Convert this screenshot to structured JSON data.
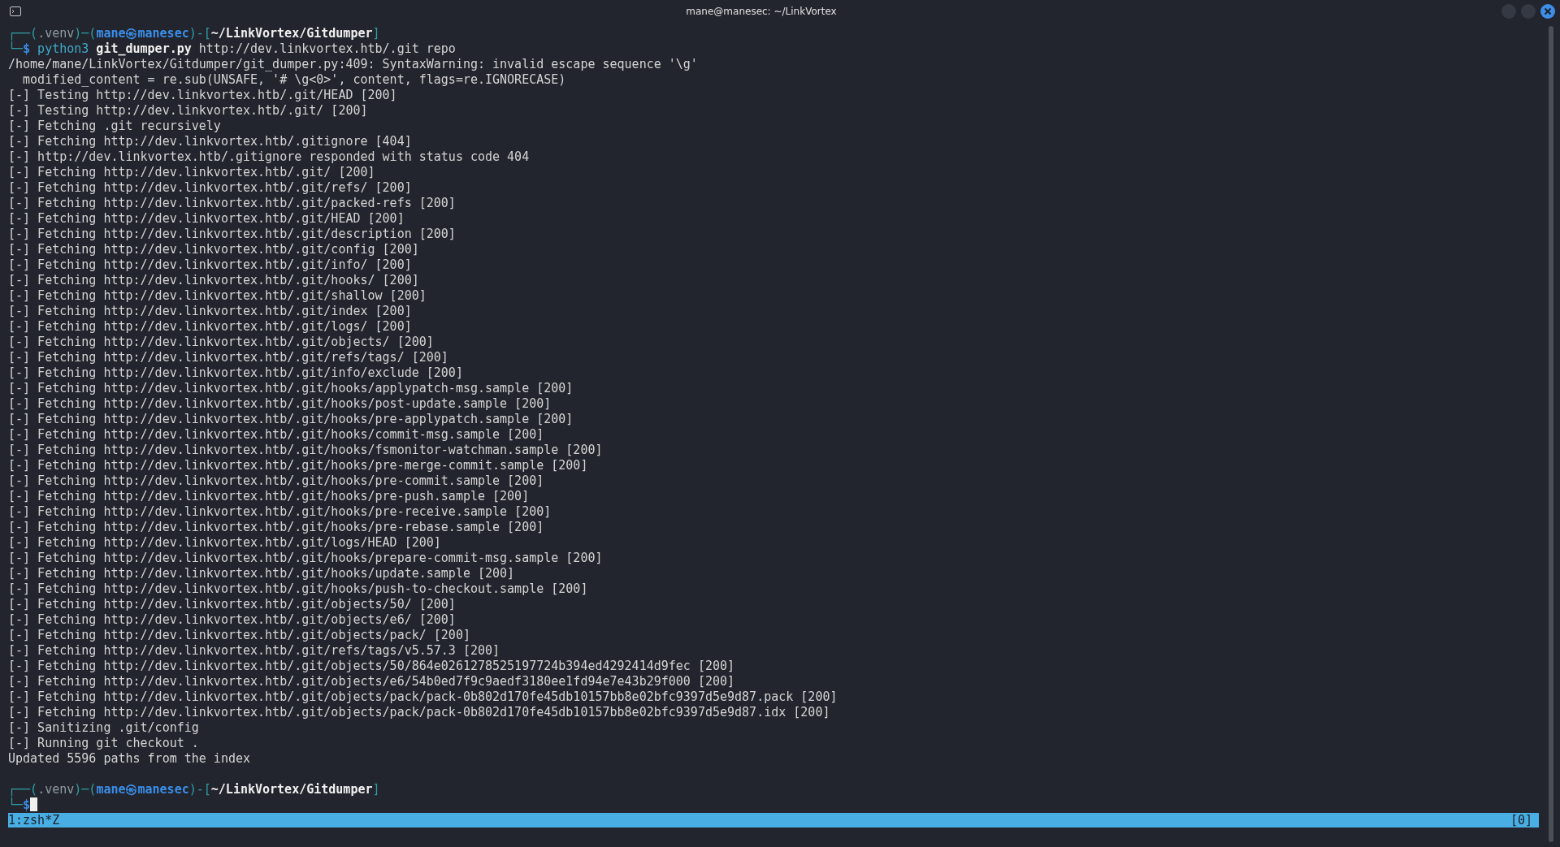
{
  "window": {
    "title": "mane@manesec: ~/LinkVortex"
  },
  "session": [
    {
      "kind": "prompt",
      "segments": [
        {
          "text": "┌──(",
          "kind": "frame"
        },
        {
          "text": ".venv",
          "kind": "venv"
        },
        {
          "text": ")─(",
          "kind": "frame"
        },
        {
          "text": "mane㉿manesec",
          "kind": "user"
        },
        {
          "text": ")-[",
          "kind": "frame"
        },
        {
          "text": "~/LinkVortex/Gitdumper",
          "kind": "path"
        },
        {
          "text": "]",
          "kind": "frame"
        }
      ]
    },
    {
      "kind": "prompt",
      "segments": [
        {
          "text": "└─",
          "kind": "frame"
        },
        {
          "text": "$",
          "kind": "user"
        },
        {
          "text": " python3",
          "kind": "program"
        },
        {
          "text": " git_dumper.py",
          "kind": "path"
        },
        {
          "text": " http://dev.linkvortex.htb/.git repo",
          "kind": "plain"
        }
      ]
    },
    {
      "kind": "output",
      "text": "/home/mane/LinkVortex/Gitdumper/git_dumper.py:409: SyntaxWarning: invalid escape sequence '\\g'"
    },
    {
      "kind": "output",
      "text": "  modified_content = re.sub(UNSAFE, '# \\g<0>', content, flags=re.IGNORECASE)"
    },
    {
      "kind": "output",
      "text": "[-] Testing http://dev.linkvortex.htb/.git/HEAD [200]"
    },
    {
      "kind": "output",
      "text": "[-] Testing http://dev.linkvortex.htb/.git/ [200]"
    },
    {
      "kind": "output",
      "text": "[-] Fetching .git recursively"
    },
    {
      "kind": "output",
      "text": "[-] Fetching http://dev.linkvortex.htb/.gitignore [404]"
    },
    {
      "kind": "output",
      "text": "[-] http://dev.linkvortex.htb/.gitignore responded with status code 404"
    },
    {
      "kind": "output",
      "text": "[-] Fetching http://dev.linkvortex.htb/.git/ [200]"
    },
    {
      "kind": "output",
      "text": "[-] Fetching http://dev.linkvortex.htb/.git/refs/ [200]"
    },
    {
      "kind": "output",
      "text": "[-] Fetching http://dev.linkvortex.htb/.git/packed-refs [200]"
    },
    {
      "kind": "output",
      "text": "[-] Fetching http://dev.linkvortex.htb/.git/HEAD [200]"
    },
    {
      "kind": "output",
      "text": "[-] Fetching http://dev.linkvortex.htb/.git/description [200]"
    },
    {
      "kind": "output",
      "text": "[-] Fetching http://dev.linkvortex.htb/.git/config [200]"
    },
    {
      "kind": "output",
      "text": "[-] Fetching http://dev.linkvortex.htb/.git/info/ [200]"
    },
    {
      "kind": "output",
      "text": "[-] Fetching http://dev.linkvortex.htb/.git/hooks/ [200]"
    },
    {
      "kind": "output",
      "text": "[-] Fetching http://dev.linkvortex.htb/.git/shallow [200]"
    },
    {
      "kind": "output",
      "text": "[-] Fetching http://dev.linkvortex.htb/.git/index [200]"
    },
    {
      "kind": "output",
      "text": "[-] Fetching http://dev.linkvortex.htb/.git/logs/ [200]"
    },
    {
      "kind": "output",
      "text": "[-] Fetching http://dev.linkvortex.htb/.git/objects/ [200]"
    },
    {
      "kind": "output",
      "text": "[-] Fetching http://dev.linkvortex.htb/.git/refs/tags/ [200]"
    },
    {
      "kind": "output",
      "text": "[-] Fetching http://dev.linkvortex.htb/.git/info/exclude [200]"
    },
    {
      "kind": "output",
      "text": "[-] Fetching http://dev.linkvortex.htb/.git/hooks/applypatch-msg.sample [200]"
    },
    {
      "kind": "output",
      "text": "[-] Fetching http://dev.linkvortex.htb/.git/hooks/post-update.sample [200]"
    },
    {
      "kind": "output",
      "text": "[-] Fetching http://dev.linkvortex.htb/.git/hooks/pre-applypatch.sample [200]"
    },
    {
      "kind": "output",
      "text": "[-] Fetching http://dev.linkvortex.htb/.git/hooks/commit-msg.sample [200]"
    },
    {
      "kind": "output",
      "text": "[-] Fetching http://dev.linkvortex.htb/.git/hooks/fsmonitor-watchman.sample [200]"
    },
    {
      "kind": "output",
      "text": "[-] Fetching http://dev.linkvortex.htb/.git/hooks/pre-merge-commit.sample [200]"
    },
    {
      "kind": "output",
      "text": "[-] Fetching http://dev.linkvortex.htb/.git/hooks/pre-commit.sample [200]"
    },
    {
      "kind": "output",
      "text": "[-] Fetching http://dev.linkvortex.htb/.git/hooks/pre-push.sample [200]"
    },
    {
      "kind": "output",
      "text": "[-] Fetching http://dev.linkvortex.htb/.git/hooks/pre-receive.sample [200]"
    },
    {
      "kind": "output",
      "text": "[-] Fetching http://dev.linkvortex.htb/.git/hooks/pre-rebase.sample [200]"
    },
    {
      "kind": "output",
      "text": "[-] Fetching http://dev.linkvortex.htb/.git/logs/HEAD [200]"
    },
    {
      "kind": "output",
      "text": "[-] Fetching http://dev.linkvortex.htb/.git/hooks/prepare-commit-msg.sample [200]"
    },
    {
      "kind": "output",
      "text": "[-] Fetching http://dev.linkvortex.htb/.git/hooks/update.sample [200]"
    },
    {
      "kind": "output",
      "text": "[-] Fetching http://dev.linkvortex.htb/.git/hooks/push-to-checkout.sample [200]"
    },
    {
      "kind": "output",
      "text": "[-] Fetching http://dev.linkvortex.htb/.git/objects/50/ [200]"
    },
    {
      "kind": "output",
      "text": "[-] Fetching http://dev.linkvortex.htb/.git/objects/e6/ [200]"
    },
    {
      "kind": "output",
      "text": "[-] Fetching http://dev.linkvortex.htb/.git/objects/pack/ [200]"
    },
    {
      "kind": "output",
      "text": "[-] Fetching http://dev.linkvortex.htb/.git/refs/tags/v5.57.3 [200]"
    },
    {
      "kind": "output",
      "text": "[-] Fetching http://dev.linkvortex.htb/.git/objects/50/864e0261278525197724b394ed4292414d9fec [200]"
    },
    {
      "kind": "output",
      "text": "[-] Fetching http://dev.linkvortex.htb/.git/objects/e6/54b0ed7f9c9aedf3180ee1fd94e7e43b29f000 [200]"
    },
    {
      "kind": "output",
      "text": "[-] Fetching http://dev.linkvortex.htb/.git/objects/pack/pack-0b802d170fe45db10157bb8e02bfc9397d5e9d87.pack [200]"
    },
    {
      "kind": "output",
      "text": "[-] Fetching http://dev.linkvortex.htb/.git/objects/pack/pack-0b802d170fe45db10157bb8e02bfc9397d5e9d87.idx [200]"
    },
    {
      "kind": "output",
      "text": "[-] Sanitizing .git/config"
    },
    {
      "kind": "output",
      "text": "[-] Running git checkout ."
    },
    {
      "kind": "output",
      "text": "Updated 5596 paths from the index"
    },
    {
      "kind": "blank"
    },
    {
      "kind": "prompt",
      "segments": [
        {
          "text": "┌──(",
          "kind": "frame"
        },
        {
          "text": ".venv",
          "kind": "venv"
        },
        {
          "text": ")─(",
          "kind": "frame"
        },
        {
          "text": "mane㉿manesec",
          "kind": "user"
        },
        {
          "text": ")-[",
          "kind": "frame"
        },
        {
          "text": "~/LinkVortex/Gitdumper",
          "kind": "path"
        },
        {
          "text": "]",
          "kind": "frame"
        }
      ]
    },
    {
      "kind": "prompt",
      "cursor": true,
      "segments": [
        {
          "text": "└─",
          "kind": "frame"
        },
        {
          "text": "$",
          "kind": "user"
        }
      ]
    }
  ],
  "status_bar": {
    "window": "1:zsh*Z",
    "pane": "[0]"
  }
}
